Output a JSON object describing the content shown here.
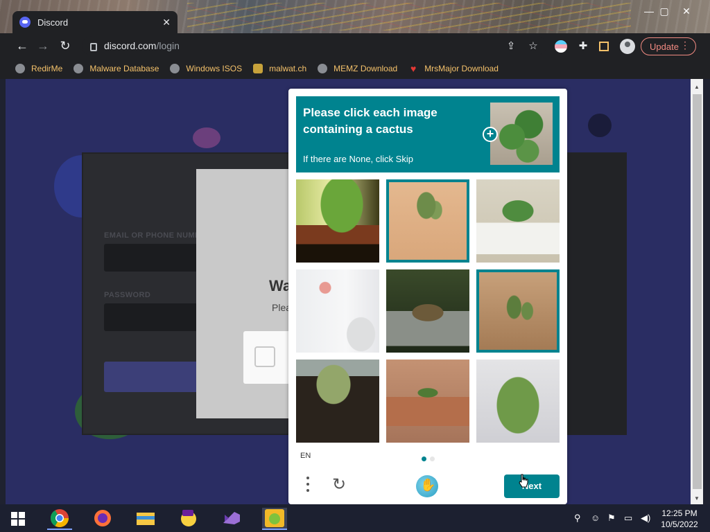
{
  "window": {
    "tab_title": "Discord",
    "tab_close": "✕",
    "controls": {
      "minimize": "—",
      "maximize": "▢",
      "close": "✕"
    }
  },
  "toolbar": {
    "url_host": "discord.com",
    "url_path": "/login",
    "update_label": "Update"
  },
  "bookmarks": [
    {
      "label": "RedirMe",
      "icon": "globe-icon"
    },
    {
      "label": "Malware Database",
      "icon": "globe-icon"
    },
    {
      "label": "Windows ISOS",
      "icon": "globe-icon"
    },
    {
      "label": "malwat.ch",
      "icon": "person-icon"
    },
    {
      "label": "MEMZ Download",
      "icon": "globe-icon"
    },
    {
      "label": "MrsMajor Download",
      "icon": "heart-icon"
    }
  ],
  "login_page": {
    "heading_partial": "Wa",
    "subtitle_partial": "Plea"
  },
  "captcha": {
    "prompt_title": "Please click each image containing a cactus",
    "prompt_subtitle": "If there are None, click Skip",
    "language": "EN",
    "next_label": "Next",
    "tiles": [
      {
        "subject": "potted plant on windowsill",
        "selected": false
      },
      {
        "subject": "cactus in sand",
        "selected": true
      },
      {
        "subject": "succulent in white pot",
        "selected": false
      },
      {
        "subject": "flower in vase",
        "selected": false
      },
      {
        "subject": "dried plant in pot",
        "selected": false
      },
      {
        "subject": "small cacti in sand",
        "selected": true
      },
      {
        "subject": "seedlings in soil",
        "selected": false
      },
      {
        "subject": "hanging plant",
        "selected": false
      },
      {
        "subject": "hanging trailing plant",
        "selected": false
      }
    ],
    "colors": {
      "accent": "#00838f"
    }
  },
  "taskbar": {
    "apps": [
      "start-icon",
      "chrome-icon",
      "firefox-icon",
      "file-explorer-icon",
      "yahoo-messenger-icon",
      "visual-studio-icon",
      "angry-birds-icon"
    ],
    "time": "12:25 PM",
    "date": "10/5/2022"
  }
}
